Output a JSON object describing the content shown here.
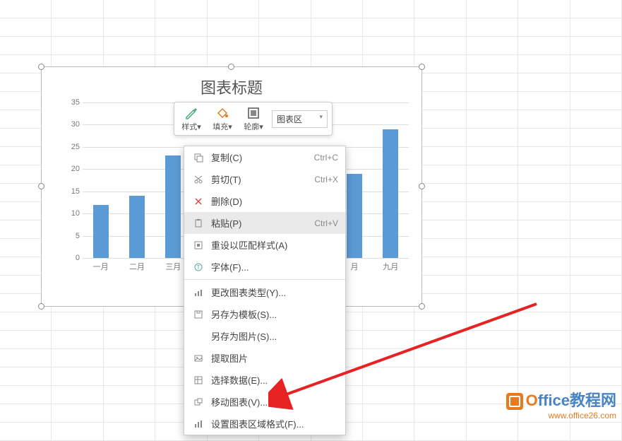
{
  "chart_data": {
    "type": "bar",
    "title": "图表标题",
    "categories": [
      "一月",
      "二月",
      "三月",
      "",
      "",
      "",
      "",
      "月",
      "九月"
    ],
    "values": [
      12,
      14,
      23,
      null,
      null,
      null,
      null,
      19,
      29
    ],
    "ylim": [
      0,
      35
    ],
    "yticks": [
      0,
      5,
      10,
      15,
      20,
      25,
      30,
      35
    ],
    "xlabel": "",
    "ylabel": ""
  },
  "mini_toolbar": {
    "style_label": "样式",
    "style_caret": "▾",
    "fill_label": "填充",
    "fill_caret": "▾",
    "outline_label": "轮廓",
    "outline_caret": "▾",
    "selector_value": "图表区"
  },
  "context_menu": {
    "copy": {
      "label": "复制(C)",
      "shortcut": "Ctrl+C"
    },
    "cut": {
      "label": "剪切(T)",
      "shortcut": "Ctrl+X"
    },
    "delete": {
      "label": "删除(D)",
      "shortcut": ""
    },
    "paste": {
      "label": "粘贴(P)",
      "shortcut": "Ctrl+V"
    },
    "reset": {
      "label": "重设以匹配样式(A)",
      "shortcut": ""
    },
    "font": {
      "label": "字体(F)...",
      "shortcut": ""
    },
    "change_type": {
      "label": "更改图表类型(Y)...",
      "shortcut": ""
    },
    "save_template": {
      "label": "另存为模板(S)...",
      "shortcut": ""
    },
    "save_image": {
      "label": "另存为图片(S)...",
      "shortcut": ""
    },
    "extract_image": {
      "label": "提取图片",
      "shortcut": ""
    },
    "select_data": {
      "label": "选择数据(E)...",
      "shortcut": ""
    },
    "move_chart": {
      "label": "移动图表(V)...",
      "shortcut": ""
    },
    "format_area": {
      "label": "设置图表区域格式(F)...",
      "shortcut": ""
    }
  },
  "watermark": {
    "brand_prefix": "O",
    "brand_rest": "ffice教程网",
    "url": "www.office26.com"
  }
}
